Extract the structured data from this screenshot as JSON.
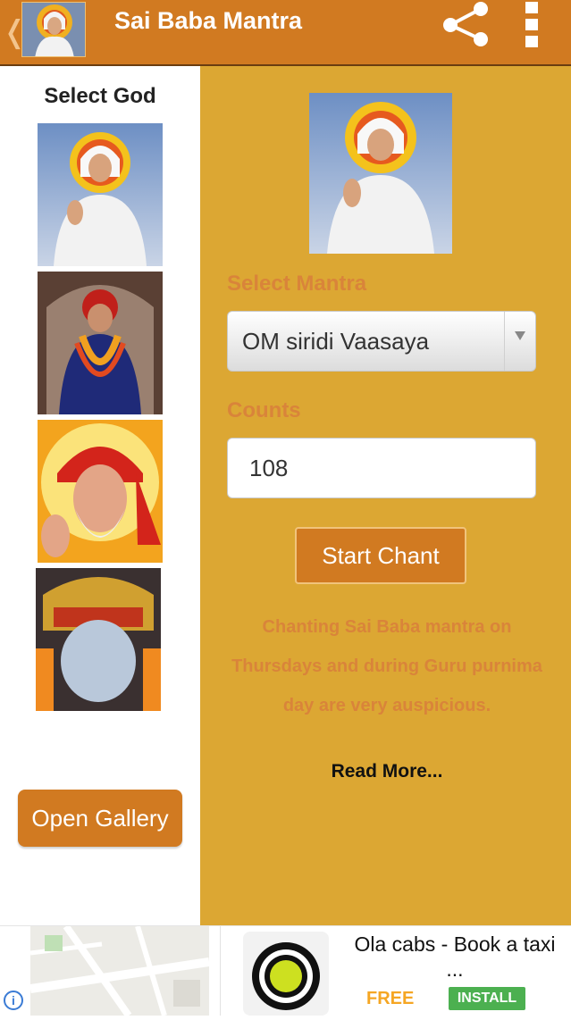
{
  "app_bar": {
    "title": "Sai Baba Mantra",
    "back_glyph": "❬",
    "logo_icon": "sai-baba-logo-icon",
    "share_icon": "share-icon",
    "overflow_icon": "overflow-menu-icon",
    "color": "#d17a21"
  },
  "left_panel": {
    "heading": "Select God",
    "thumbnails": [
      {
        "name": "god-thumbnail-1"
      },
      {
        "name": "god-thumbnail-2"
      },
      {
        "name": "god-thumbnail-3"
      },
      {
        "name": "god-thumbnail-4"
      }
    ],
    "gallery_button": "Open Gallery"
  },
  "right_panel": {
    "mantra_label": "Select Mantra",
    "mantra_value": "OM siridi Vaasaya",
    "counts_label": "Counts",
    "counts_value": "108",
    "start_button": "Start Chant",
    "info_text": "Chanting Sai Baba mantra on Thursdays and during Guru purnima day are very auspicious.",
    "read_more": "Read More...",
    "background": "#dca733",
    "accent": "#d9843a"
  },
  "ad": {
    "title": "Ola cabs - Book a taxi ...",
    "free_label": "FREE",
    "install_label": "INSTALL",
    "info_glyph": "i"
  }
}
